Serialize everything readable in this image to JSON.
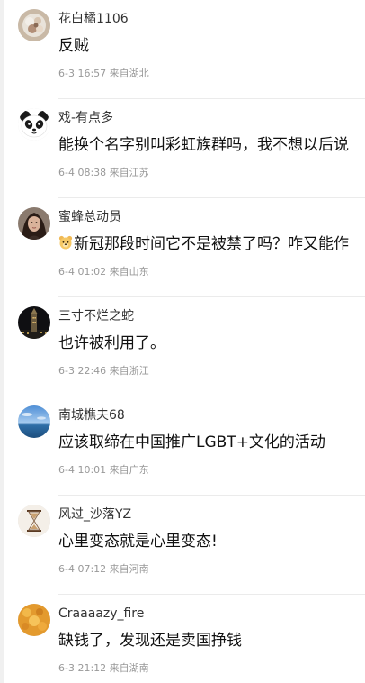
{
  "comments": [
    {
      "username": "花白橘1106",
      "text": "反贼",
      "date": "6-3 16:57",
      "location": "来自湖北",
      "avatar_icon": "flower-photo"
    },
    {
      "username": "戏-有点多",
      "text": "能换个名字别叫彩虹族群吗，我不想以后说",
      "date": "6-4 08:38",
      "location": "来自江苏",
      "avatar_icon": "panda"
    },
    {
      "username": "蜜蜂总动员",
      "text": "新冠那段时间它不是被禁了吗？咋又能作",
      "emoji_icon": "bear-face",
      "date": "6-4 01:02",
      "location": "来自山东",
      "avatar_icon": "woman-portrait"
    },
    {
      "username": "三寸不烂之蛇",
      "text": "也许被利用了。",
      "date": "6-3 22:46",
      "location": "来自浙江",
      "avatar_icon": "night-tower"
    },
    {
      "username": "南城樵夫68",
      "text": "应该取缔在中国推广LGBT+文化的活动",
      "date": "6-4 10:01",
      "location": "来自广东",
      "avatar_icon": "sea-sky"
    },
    {
      "username": "风过_沙落YZ",
      "text": "心里变态就是心里变态!",
      "date": "6-4 07:12",
      "location": "来自河南",
      "avatar_icon": "hourglass"
    },
    {
      "username": "Craaaazy_fire",
      "text": "缺钱了，发现还是卖国挣钱",
      "date": "6-3 21:12",
      "location": "来自湖南",
      "avatar_icon": "orange-food"
    }
  ]
}
